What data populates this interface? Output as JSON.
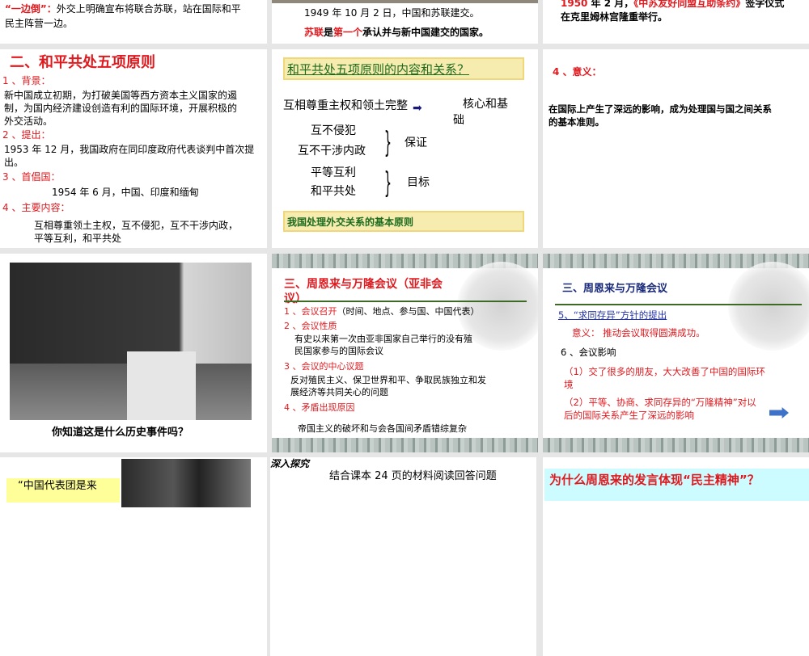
{
  "row1": {
    "s1": {
      "label": "“一边倒”：",
      "text1": "外交上明确宣布将联合苏联，站在国际和平",
      "text2": "民主阵营一边。"
    },
    "s2": {
      "line1": "1949 年 10 月 2 日，中国和苏联建交。",
      "red1": "苏联",
      "mid1": "是",
      "red2": "第一个",
      "rest": "承认并与新中国建交的国家。"
    },
    "s3": {
      "year": "1950",
      "t1": " 年 2 月，",
      "treaty": "《中苏友好同盟互助条约》",
      "t2": "签字仪式",
      "line2": "在克里姆林宫隆重举行。"
    }
  },
  "row2": {
    "s1": {
      "title": "二、和平共处五项原则",
      "h1": "1 、背景：",
      "p1a": "新中国成立初期，为打破美国等西方资本主义国家的遏",
      "p1b": "制，为国内经济建设创造有利的国际环境，开展积极的",
      "p1c": "外交活动。",
      "h2": "2 、提出：",
      "p2a": "1953 年 12 月，我国政府在同印度政府代表谈判中首次提",
      "p2b": "出。",
      "h3": "3 、首倡国：",
      "p3": "1954 年 6 月，中国、印度和缅甸",
      "h4": "4 、主要内容：",
      "p4a": "互相尊重领土主权，互不侵犯，互不干涉内政，",
      "p4b": "平等互利，和平共处"
    },
    "s2": {
      "question": "和平共处五项原则的内容和关系？",
      "p1": "互相尊重主权和领土完整",
      "r1a": "核心和基",
      "r1b": "础",
      "p2": "互不侵犯",
      "p3": "互不干涉内政",
      "r2": "保证",
      "p4": "平等互利",
      "p5": "和平共处",
      "r3": "目标",
      "bottom": "我国处理外交关系的基本原则"
    },
    "s3": {
      "heading": "4 、意义：",
      "text1": "在国际上产生了深远的影响，成为处理国与国之间关系",
      "text2": "的基本准则。"
    }
  },
  "row3": {
    "s1": {
      "caption": "你知道这是什么历史事件吗？"
    },
    "s2": {
      "title1": "三、周恩来与万隆会议（亚非会",
      "title2": "议）",
      "h1": "1 、会议召开",
      "h1b": "（时间、地点、参与国、中国代表）",
      "h2": "2 、会议性质",
      "p2a": "有史以来第一次由亚非国家自己举行的没有殖",
      "p2b": "民国家参与的国际会议",
      "h3": "3 、会议的中心议题",
      "p3a": "反对殖民主义、保卫世界和平、争取民族独立和发",
      "p3b": "展经济等共同关心的问题",
      "h4": "4 、矛盾出现原因",
      "p4": "帝国主义的破坏和与会各国间矛盾错综复杂"
    },
    "s3": {
      "title": "三、周恩来与万隆会议",
      "link": "5、“求同存异”方针的提出",
      "meaning": "意义： 推动会议取得圆满成功。",
      "h6": "6 、会议影响",
      "p1a": "（1）交了很多的朋友，大大改善了中国的国际环",
      "p1b": "境",
      "p2a": "（2）平等、协商、求同存异的“万隆精神”对以",
      "p2b": "后的国际关系产生了深远的影响"
    }
  },
  "row4": {
    "s1": {
      "quote": "“中国代表团是来"
    },
    "s2": {
      "stamp": "深入探究",
      "text": "结合课本 24 页的材料阅读回答问题"
    },
    "s3": {
      "question": "为什么周恩来的发言体现“民主精神”？"
    }
  }
}
